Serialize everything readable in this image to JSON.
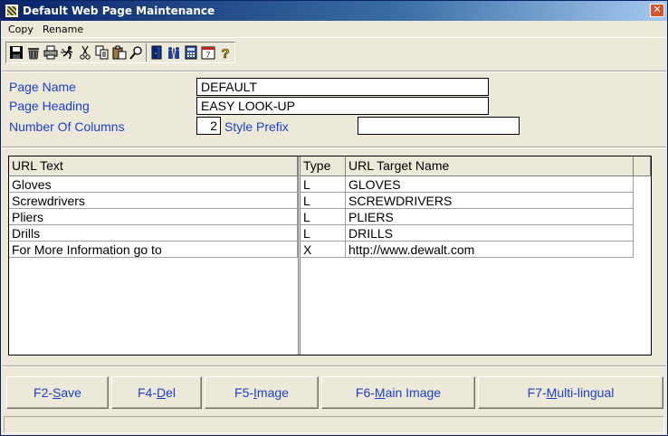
{
  "window": {
    "title": "Default Web Page Maintenance",
    "close_glyph": "✕"
  },
  "menu": {
    "items": [
      "Copy",
      "Rename"
    ]
  },
  "toolbar": {
    "icons": [
      "save-icon",
      "delete-icon",
      "print-icon",
      "run-icon",
      "cut-icon",
      "copy-icon",
      "paste-icon",
      "find-icon",
      "exit-door-icon",
      "users-icon",
      "calculator-icon",
      "calendar-icon",
      "help-icon"
    ]
  },
  "form": {
    "page_name_label": "Page Name",
    "page_name_value": "DEFAULT",
    "page_heading_label": "Page Heading",
    "page_heading_value": "EASY LOOK-UP",
    "num_columns_label": "Number Of Columns",
    "num_columns_value": "2",
    "style_prefix_label": "Style Prefix",
    "style_prefix_value": ""
  },
  "grid": {
    "headers": [
      "URL Text",
      "Type",
      "URL Target Name"
    ],
    "rows": [
      [
        "Gloves",
        "L",
        "GLOVES"
      ],
      [
        "Screwdrivers",
        "L",
        "SCREWDRIVERS"
      ],
      [
        "Pliers",
        "L",
        "PLIERS"
      ],
      [
        "Drills",
        "L",
        "DRILLS"
      ],
      [
        "For More Information go to",
        "X",
        "http://www.dewalt.com"
      ]
    ]
  },
  "fkeys": [
    {
      "prefix": "F2-",
      "hot": "S",
      "rest": "ave"
    },
    {
      "prefix": "F4-",
      "hot": "D",
      "rest": "el"
    },
    {
      "prefix": "F5-",
      "hot": "I",
      "rest": "mage"
    },
    {
      "prefix": "F6-",
      "hot": "M",
      "rest": "ain Image"
    },
    {
      "prefix": "F7-",
      "hot": "M",
      "rest": "ulti-lingual"
    }
  ],
  "colors": {
    "label_blue": "#1a3fd1",
    "titlebar_start": "#0a246a",
    "face": "#ece9d8"
  }
}
